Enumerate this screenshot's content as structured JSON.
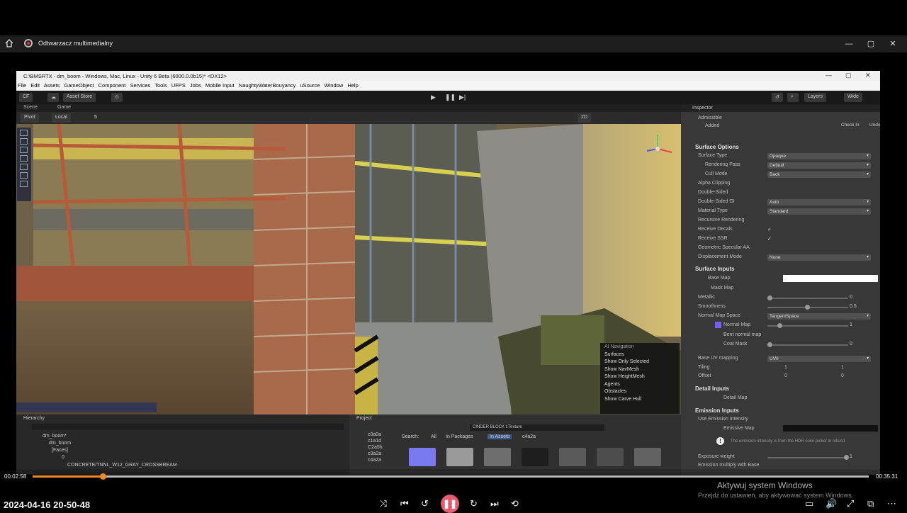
{
  "player": {
    "title": "Odtwarzacz multimedialny",
    "current_time": "00:02:58",
    "total_time": "00:35:31",
    "progress": 0.084,
    "timestamp_overlay": "2024-04-16 20-50-48",
    "activate_title": "Aktywuj system Windows",
    "activate_sub": "Przejdź do ustawień, aby aktywować system Windows."
  },
  "unity": {
    "window_title": "C:\\BMSRTX - dm_boom - Windows, Mac, Linux - Unity 6 Beta (6000.0.0b15)* <DX12>",
    "menu": [
      "File",
      "Edit",
      "Assets",
      "GameObject",
      "Component",
      "Services",
      "Tools",
      "UFPS",
      "Jobs",
      "Mobile Input",
      "NaughtyWaterBouyancy",
      "uSource",
      "Window",
      "Help"
    ],
    "toolbar": {
      "account": "CF",
      "asset_store": "Asset Store",
      "layers": "Layers",
      "layout": "Wide"
    },
    "tabs": {
      "scene": "Scene",
      "game": "Game",
      "inspector": "Inspector",
      "hierarchy": "Hierarchy",
      "project": "Project"
    },
    "scene_tools": {
      "pivot": "Pivot",
      "local": "Local",
      "grid_value": "5",
      "mode_2d": "2D"
    }
  },
  "ai_navigation": {
    "title": "AI Navigation",
    "items": [
      "Surfaces",
      "Show Only Selected",
      "Show NavMesh",
      "Show HeightMesh",
      "Agents",
      "Obstacles",
      "Show Carve Hull"
    ]
  },
  "inspector": {
    "admissible": "Admissible",
    "added": "Added",
    "check_in": "Check In",
    "undo": "Undo",
    "surface_options": "Surface Options",
    "surface_rows": [
      {
        "label": "Surface Type",
        "value": "Opaque"
      },
      {
        "label": "Rendering Pass",
        "value": "Default"
      },
      {
        "label": "Cull Mode",
        "value": "Back"
      },
      {
        "label": "Alpha Clipping",
        "value": ""
      },
      {
        "label": "Double-Sided",
        "value": ""
      },
      {
        "label": "Double-Sided GI",
        "value": "Auto"
      },
      {
        "label": "Material Type",
        "value": "Standard"
      },
      {
        "label": "Recursive Rendering",
        "value": ""
      },
      {
        "label": "Receive Decals",
        "value": "✓"
      },
      {
        "label": "Receive SSR",
        "value": "✓"
      },
      {
        "label": "Geometric Specular AA",
        "value": ""
      },
      {
        "label": "Displacement Mode",
        "value": "None"
      }
    ],
    "surface_inputs": "Surface Inputs",
    "base_map": "Base Map",
    "mask_map": "Mask Map",
    "metallic": {
      "label": "Metallic",
      "value": "0"
    },
    "smoothness": {
      "label": "Smoothness",
      "value": "0.5"
    },
    "normal_map_space": {
      "label": "Normal Map Space",
      "value": "TangentSpace"
    },
    "normal_map": {
      "label": "Normal Map",
      "value": "1"
    },
    "bent_normal": "Bent normal map",
    "coat_mask": {
      "label": "Coat Mask",
      "value": "0"
    },
    "base_uv": {
      "label": "Base UV mapping",
      "value": "UV0"
    },
    "tiling": {
      "label": "Tiling",
      "x": "1",
      "y": "1"
    },
    "offset": {
      "label": "Offset",
      "x": "0",
      "y": "0"
    },
    "detail_inputs": "Detail Inputs",
    "detail_map": "Detail Map",
    "emission_inputs": "Emission Inputs",
    "use_emission": "Use Emission Intensity",
    "emissive_map": "Emissive Map",
    "emission_note": "The emission intensity is from the HDR color picker in nits/cd",
    "exposure_weight": {
      "label": "Exposure weight",
      "value": "1"
    },
    "emission_multiply": "Emission multiply with Base"
  },
  "hierarchy": {
    "items": [
      "dm_boom*",
      "dm_boom",
      "[Faces]",
      "0",
      "CONCRETE/TNNL_W12_GRAY_CROSSBREAM"
    ]
  },
  "project": {
    "search_label": "Search:",
    "filters": [
      "All",
      "In Packages",
      "In Assets",
      "c4a2a"
    ],
    "search_query": "CINDER BLOCK t:Texture",
    "folders": [
      "c0a0a",
      "c1a1d",
      "C2a5h",
      "c3a2a",
      "c4a2a"
    ]
  },
  "colors": {
    "accent": "#f08a24",
    "pause": "#e45b72",
    "normal_swatch": "#7a5cf2"
  }
}
